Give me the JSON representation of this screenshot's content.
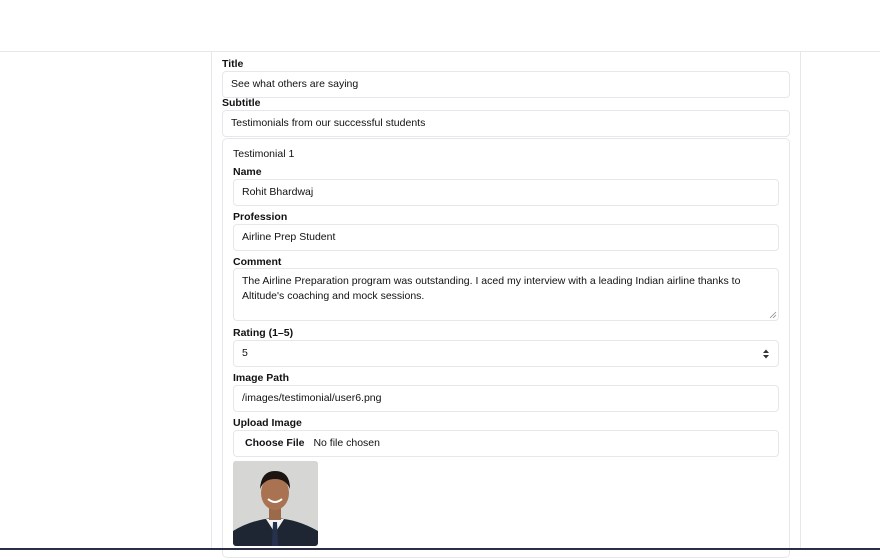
{
  "form": {
    "title_label": "Title",
    "title_value": "See what others are saying",
    "subtitle_label": "Subtitle",
    "subtitle_value": "Testimonials from our successful students"
  },
  "testimonial": {
    "heading": "Testimonial 1",
    "name_label": "Name",
    "name_value": "Rohit Bhardwaj",
    "profession_label": "Profession",
    "profession_value": "Airline Prep Student",
    "comment_label": "Comment",
    "comment_value": "The Airline Preparation program was outstanding. I aced my interview with a leading Indian airline thanks to Altitude's coaching and mock sessions.",
    "rating_label": "Rating (1–5)",
    "rating_value": "5",
    "image_path_label": "Image Path",
    "image_path_value": "/images/testimonial/user6.png",
    "upload_label": "Upload Image",
    "upload_button": "Choose File",
    "upload_status": "No file chosen"
  }
}
